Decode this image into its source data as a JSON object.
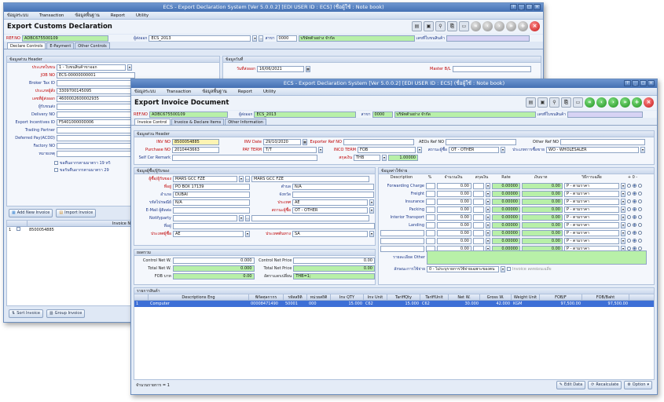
{
  "back": {
    "title": "ECS - Export Declaration System [Ver 5.0.0.2] [EDI USER ID : ECS] (ชื่อผู้ใช้ : Note book)",
    "menu": [
      "ข้อมูลระบบ",
      "Transaction",
      "ข้อมูลพื้นฐาน",
      "Report",
      "Utility"
    ],
    "doc_title": "Export Customs Declaration",
    "ref_no_label": "REF.NO",
    "ref_no": "ADBC675500109",
    "exporter_label": "ผู้ส่งออก",
    "exporter": "ECS_2013",
    "branch_label": "สาขา",
    "branch": "0000",
    "company": "บริษัทตัวอย่าง จำกัด",
    "declare_no_label": "เลขที่ใบขนสินค้า",
    "tabs": [
      "Declare Controls",
      "E-Payment",
      "Other Controls"
    ],
    "header_title": "ข้อมูลส่วน Header",
    "date_title": "ข้อมูลวันที่",
    "fields": [
      {
        "label": "ประเภทใบขน",
        "value": "1 - ใบขนสินค้าขาออก"
      },
      {
        "label": "JOB NO",
        "value": "ECS-00000000001"
      },
      {
        "label": "Broker Tax ID",
        "value": ""
      },
      {
        "label": "ประเภทผู้สั่ง",
        "value": "3309700145095"
      },
      {
        "label": "เลขที่ผู้ส่งออก",
        "value": "4600002600002935"
      },
      {
        "label": "ผู้รับขนส่ง",
        "value": ""
      },
      {
        "label": "Delivery NO",
        "value": ""
      },
      {
        "label": "Export Incentives ID",
        "value": "F5401000000006"
      },
      {
        "label": "Trading Partner",
        "value": ""
      },
      {
        "label": "Deferred Pay(ACDD)",
        "value": ""
      },
      {
        "label": "Factory NO",
        "value": ""
      },
      {
        "label": "หมายเหตุ",
        "value": ""
      }
    ],
    "date_label": "วันที่ส่งออก",
    "date_value": "16/06/2021",
    "master_bl_label": "Master B/L",
    "checks": [
      "ขอคืนอากรตามมาตรา 19 ทวิ",
      "ขอรับคืนอากรตามมาตรา 29"
    ],
    "add_invoice": "Add New Invoice",
    "import_invoice": "Import Invoice",
    "invoice_col": "Invoice NO",
    "invoice_rows": [
      {
        "idx": "1",
        "no": "8500054885"
      }
    ],
    "sort_invoice": "Sort Invoice",
    "group_invoice": "Group Invoice"
  },
  "front": {
    "title": "ECS - Export Declaration System [Ver 5.0.0.2] [EDI USER ID : ECS] (ชื่อผู้ใช้ : Note book)",
    "menu": [
      "ข้อมูลระบบ",
      "Transaction",
      "ข้อมูลพื้นฐาน",
      "Report",
      "Utility"
    ],
    "doc_title": "Export Invoice Document",
    "ref_no_label": "REF.NO",
    "ref_no": "ADBC675500109",
    "exporter_label": "ผู้ส่งออก",
    "exporter": "ECS_2013",
    "branch_label": "สาขา",
    "branch": "0000",
    "company": "บริษัทตัวอย่าง จำกัด",
    "declare_no_label": "เลขที่ใบขนสินค้า",
    "tabs": [
      "Invoice Control",
      "Invoice & Declare Items",
      "Other Information"
    ],
    "header_title": "ข้อมูลส่วน Header",
    "inv_no_label": "INV NO",
    "inv_no": "8500054885",
    "inv_date_label": "INV Date",
    "inv_date": "29/10/2020",
    "exporter_ref_label": "Exporter Ref NO",
    "aeos_ref_label": "AEOs Ref NO",
    "other_ref_label": "Other Ref NO",
    "purchase_label": "Purchase NO",
    "purchase": "2010443663",
    "pay_term_label": "PAY TERM",
    "pay_term": "T/T",
    "inco_term_label": "INCO TERM",
    "inco_term": "FOB",
    "trade_label": "สถานะผู้ซื้อ",
    "trade": "OT - OTHER",
    "buyer_type_label": "ประเภทการซื้อขาย",
    "buyer_type": "WO - WHOLESALER",
    "self_cer_label": "Self Cer Remark",
    "currency_label": "สกุลเงิน",
    "currency": "THB",
    "rate": "1.00000",
    "buyer_title": "ข้อมูลผู้ซื้อ/ผู้รับของ",
    "buyer_label": "ผู้ซื้อ/ผู้รับของ",
    "buyer_code": "MARS GCC FZE",
    "buyer_name": "MARS GCC FZE",
    "address_label": "ที่อยู่",
    "address": "PO BOX 17139",
    "district_label": "ตำบล",
    "district": "N/A",
    "city_label": "อำเภอ",
    "city": "DUBAI",
    "province_label": "จังหวัด",
    "province": "",
    "postcode_label": "รหัสไปรษณีย์",
    "postcode": "N/A",
    "country_label": "ประเทศ",
    "country": "AE",
    "email_label": "E-Mail ผู้ติดต่อ",
    "buyer_status_label": "สถานะผู้ซื้อ",
    "buyer_status": "OT - OTHER",
    "notify_label": "Notifyparty",
    "notify_addr_label": "ที่อยู่",
    "dest_country_label": "ประเทศผู้ซื้อ",
    "dest_country": "AE",
    "origin_country_label": "ประเทศต้นทาง",
    "origin_country": "SA",
    "summary_title": "ยอดรวม",
    "control_netw_label": "Control Net W.",
    "control_netw": "0.000",
    "control_netp_label": "Control Net Price",
    "control_netp": "0.00",
    "total_netw_label": "Total Net W.",
    "total_netw": "0.000",
    "total_netp_label": "Total Net Price",
    "total_netp": "0.00",
    "fob_label": "FOB บาท",
    "fob": "0.00",
    "exchange_label": "อัตราแลกเปลี่ยน",
    "exchange": "THB=1;",
    "charges_title": "ข้อมูลค่าใช้จ่าย",
    "charges_head": [
      "Description",
      "%",
      "จำนวนเงิน",
      "สกุลเงิน",
      "Rate",
      "เงินบาท",
      "วิธีการเฉลี่ย",
      "+ 0 -"
    ],
    "charges": [
      {
        "desc": "Forwarding Charge",
        "amt": "0.00",
        "rate": "0.00000",
        "thb": "0.00",
        "method": "P - ตามราคา"
      },
      {
        "desc": "Freight",
        "amt": "0.00",
        "rate": "0.00000",
        "thb": "0.00",
        "method": "P - ตามราคา"
      },
      {
        "desc": "Insurance",
        "amt": "0.00",
        "rate": "0.00000",
        "thb": "0.00",
        "method": "P - ตามราคา"
      },
      {
        "desc": "Packing",
        "amt": "0.00",
        "rate": "0.00000",
        "thb": "0.00",
        "method": "P - ตามราคา"
      },
      {
        "desc": "Interior Transport",
        "amt": "0.00",
        "rate": "0.00000",
        "thb": "0.00",
        "method": "P - ตามราคา"
      },
      {
        "desc": "Landing",
        "amt": "0.00",
        "rate": "0.00000",
        "thb": "0.00",
        "method": "P - ตามราคา"
      },
      {
        "desc": "",
        "amt": "0.00",
        "rate": "0.00000",
        "thb": "0.00",
        "method": "P - ตามราคา"
      },
      {
        "desc": "",
        "amt": "0.00",
        "rate": "0.00000",
        "thb": "0.00",
        "method": "P - ตามราคา"
      },
      {
        "desc": "",
        "amt": "0.00",
        "rate": "0.00000",
        "thb": "0.00",
        "method": "P - ตามราคา"
      }
    ],
    "charge_other_label": "รายละเอียด Other",
    "calc_method_label": "ลักษณะการใช้จ่าย",
    "calc_method": "0 - ไม่ระบุรายการใช้จ่ายเฉพาะของตน",
    "calc_check_label": "Invoice ลดหย่อนเฉลี่ย",
    "items_title": "รายการสินค้า",
    "items_head": [
      "",
      "Descriptions Eng",
      "พิกัดศุลกากร",
      "รหัสสถิติ",
      "หน่วยสถิติ",
      "Inv QTY",
      "Inv Unit",
      "TariffQty",
      "TariffUnit",
      "Net W.",
      "Gross W.",
      "Weight Unit",
      "FOB/F",
      "FOB/Baht"
    ],
    "items": [
      {
        "idx": "1",
        "desc": "Computer",
        "tariff": "00008471490",
        "stat": "50001",
        "stat_unit": "000",
        "qty": "15.000",
        "unit": "C62",
        "tqty": "15.000",
        "tunit": "C62",
        "netw": "30.000",
        "gross": "42.000",
        "wunit": "KGM",
        "fobf": "97,500.00",
        "fobb": "97,500.00"
      }
    ],
    "item_count_label": "จำนวนรายการ = 1",
    "edit_data": "Edit Data",
    "recalculate": "Recalculate",
    "option": "Option"
  }
}
